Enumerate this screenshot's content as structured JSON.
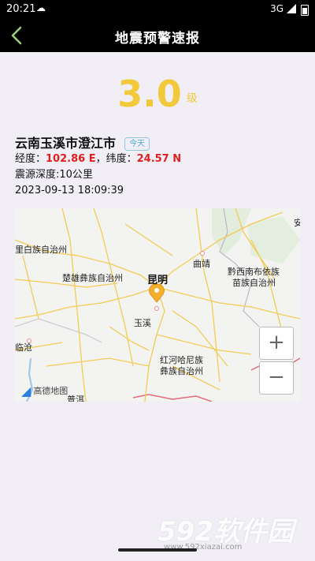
{
  "status_bar": {
    "time": "20:21",
    "network": "3G",
    "icons": [
      "cloud-icon",
      "signal-icon",
      "battery-icon"
    ]
  },
  "header": {
    "title": "地震预警速报",
    "back_icon": "chevron-left-icon",
    "back_color": "#9bd37a"
  },
  "quake": {
    "magnitude": "3.0",
    "magnitude_unit": "级",
    "location": "云南玉溪市澄江市",
    "badge": "今天",
    "lon_label": "经度：",
    "lon_value": "102.86 E",
    "lat_label": "，纬度：",
    "lat_value": "24.57 N",
    "depth": "震源深度:10公里",
    "time": "2023-09-13 18:09:39"
  },
  "map": {
    "labels": {
      "left_top": "里白族自治州",
      "chuxiong": "楚雄彝族自治州",
      "kunming": "昆明",
      "qujing": "曲靖",
      "qiannan": "黔西南布依族",
      "qiannan2": "苗族自治州",
      "yuxi": "玉溪",
      "lincang": "临沧",
      "honghe1": "红河哈尼族",
      "honghe2": "彝族自治州",
      "bottom_partial": "普洱",
      "corner_partial": "安"
    },
    "zoom_in": "+",
    "zoom_out": "−",
    "logo": "高德地图",
    "marker_color": "#f3b02c"
  },
  "watermark": {
    "text": "592软件园",
    "url": "www.592xiazai.com"
  },
  "colors": {
    "accent": "#f3c93c",
    "coordinate": "#e02020",
    "badge": "#4aa7d6"
  }
}
